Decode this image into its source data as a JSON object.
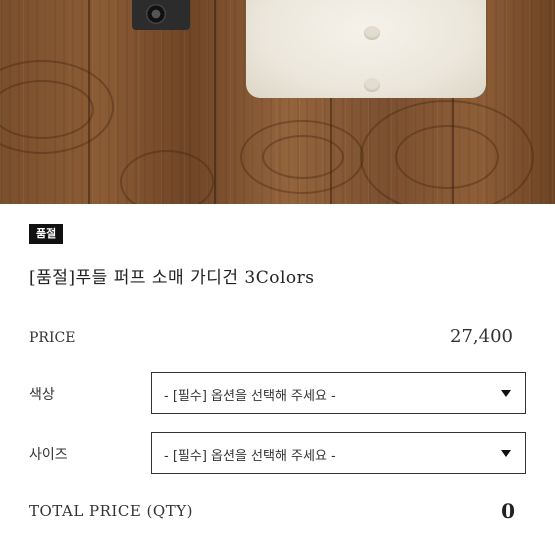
{
  "product": {
    "status_badge": "품절",
    "title": "[품절]푸들 퍼프 소매 가디건 3Colors"
  },
  "price": {
    "label": "PRICE",
    "value": "27,400"
  },
  "options": [
    {
      "label": "색상",
      "selected": "- [필수] 옵션을 선택해 주세요 -"
    },
    {
      "label": "사이즈",
      "selected": "- [필수] 옵션을 선택해 주세요 -"
    }
  ],
  "total": {
    "label": "TOTAL PRICE (QTY)",
    "value": "0"
  }
}
